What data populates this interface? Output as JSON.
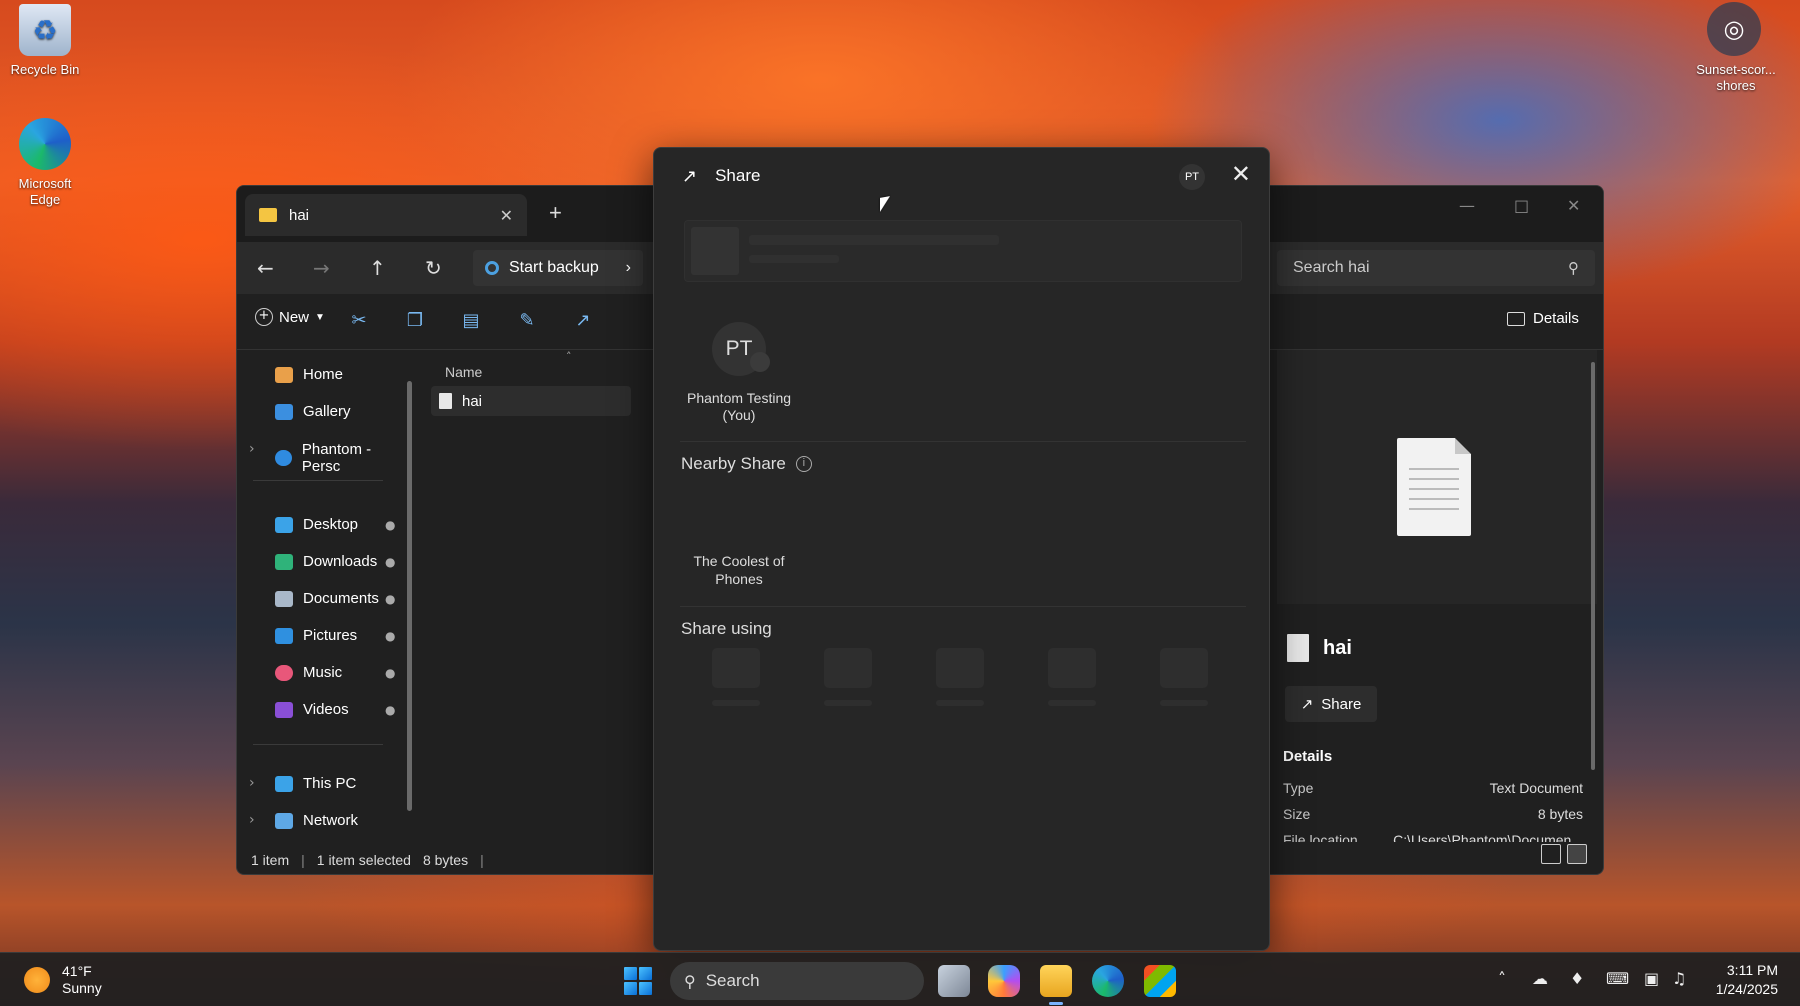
{
  "desktop": {
    "icons": [
      {
        "label": "Recycle Bin"
      },
      {
        "label": "Microsoft Edge"
      }
    ],
    "spotlight_label": "Sunset-scor... shores"
  },
  "explorer": {
    "tab_title": "hai",
    "backup_label": "Start backup",
    "search_placeholder": "Search hai",
    "new_label": "New",
    "details_label": "Details",
    "nav": {
      "home": "Home",
      "gallery": "Gallery",
      "onedrive": "Phantom - Persc",
      "desktop": "Desktop",
      "downloads": "Downloads",
      "documents": "Documents",
      "pictures": "Pictures",
      "music": "Music",
      "videos": "Videos",
      "this_pc": "This PC",
      "network": "Network"
    },
    "column_name": "Name",
    "file_name": "hai",
    "status": {
      "items": "1 item",
      "selected": "1 item selected",
      "size": "8 bytes"
    },
    "details_pane": {
      "file_name": "hai",
      "share_label": "Share",
      "heading": "Details",
      "rows": [
        {
          "k": "Type",
          "v": "Text Document"
        },
        {
          "k": "Size",
          "v": "8 bytes"
        },
        {
          "k": "File location",
          "v": "C:\\Users\\Phantom\\Documen..."
        }
      ]
    }
  },
  "share_dialog": {
    "title": "Share",
    "account_initials": "PT",
    "contact": {
      "initials": "PT",
      "name": "Phantom Testing (You)"
    },
    "nearby_title": "Nearby Share",
    "nearby_device": "The Coolest of Phones",
    "share_using_title": "Share using"
  },
  "taskbar": {
    "weather_temp": "41°F",
    "weather_desc": "Sunny",
    "search_label": "Search",
    "time": "3:11 PM",
    "date": "1/24/2025"
  }
}
